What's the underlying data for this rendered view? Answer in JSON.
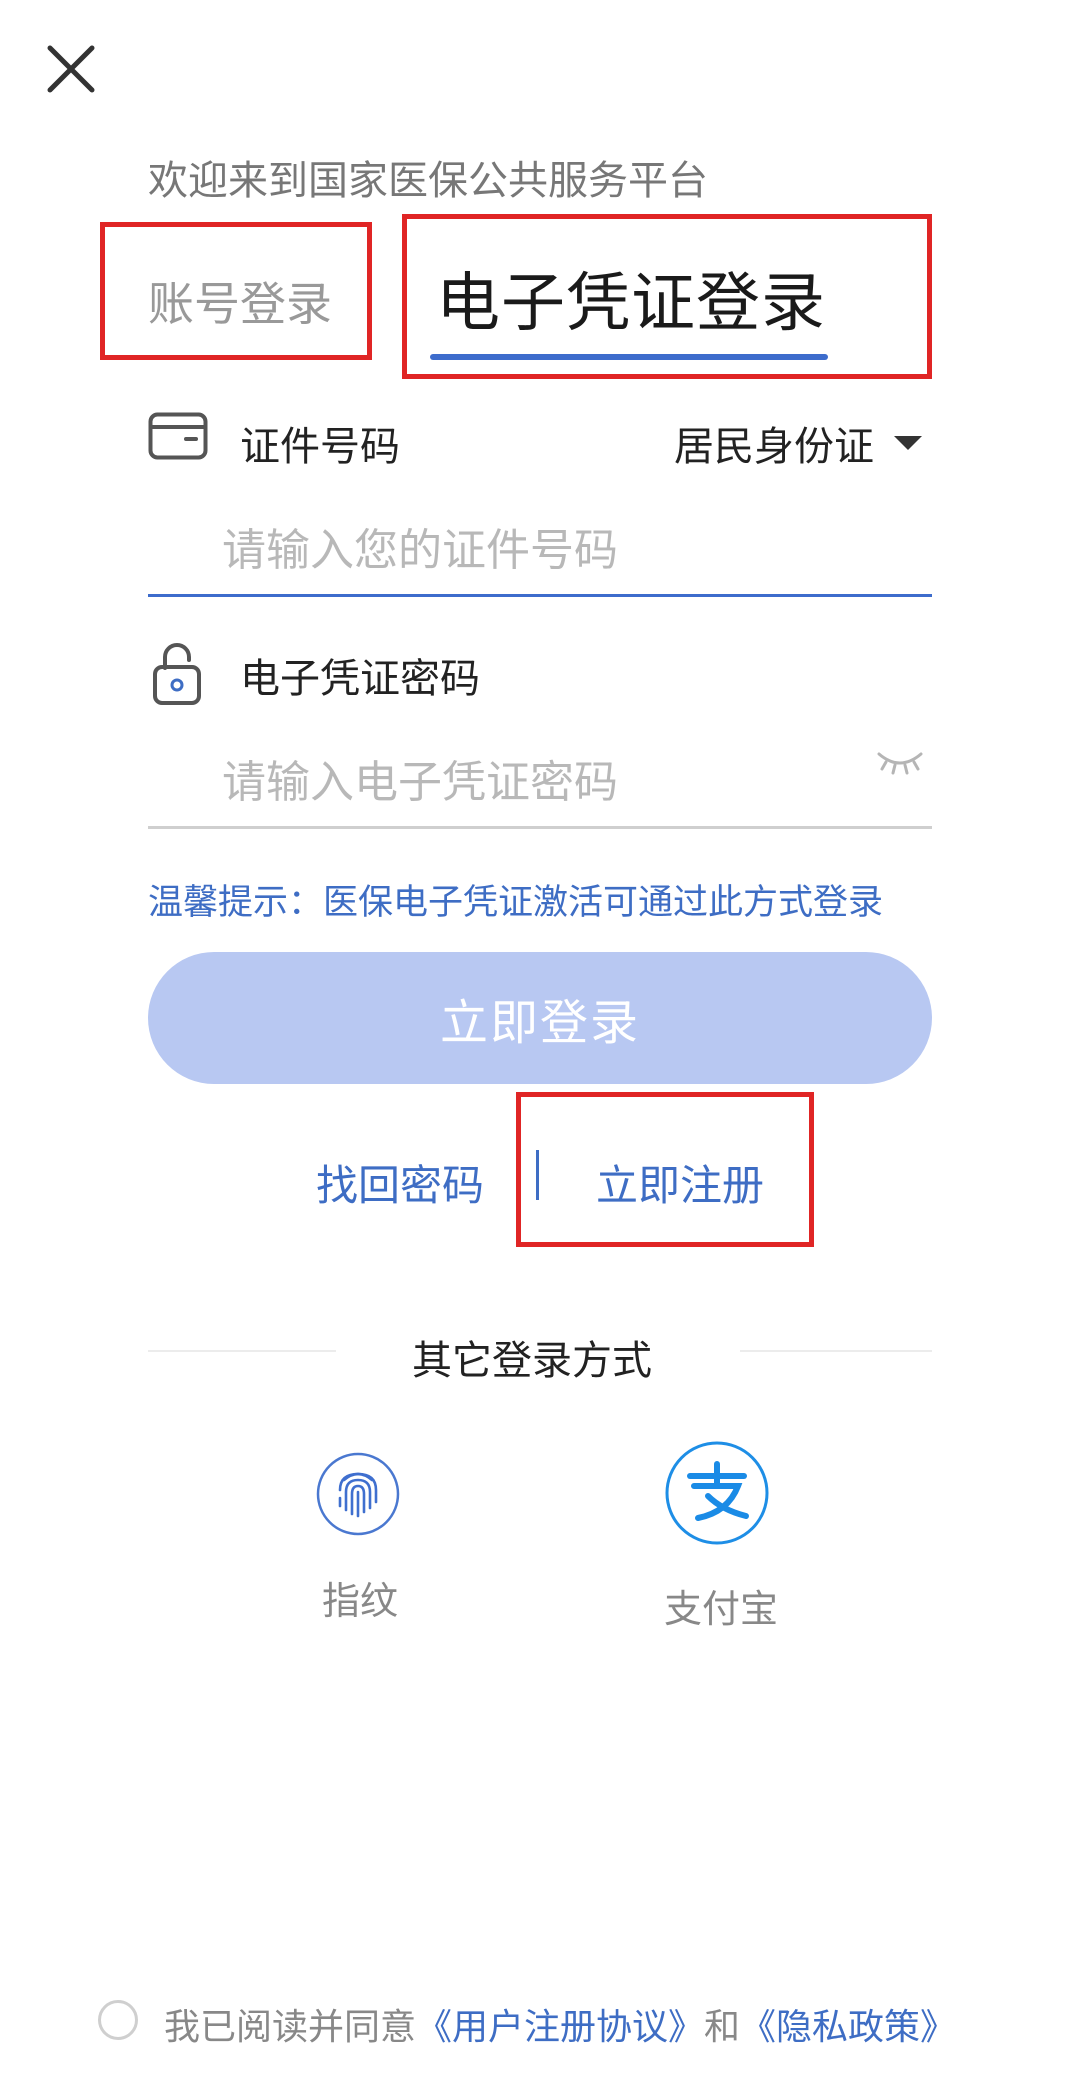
{
  "header": {
    "close_icon": "close-icon",
    "welcome": "欢迎来到国家医保公共服务平台"
  },
  "tabs": {
    "account": "账号登录",
    "ecert": "电子凭证登录",
    "active": "ecert",
    "active_color": "#3d6ccc",
    "highlight_color": "#e02525"
  },
  "id_field": {
    "icon": "id-card-icon",
    "label": "证件号码",
    "type_value": "居民身份证",
    "placeholder": "请输入您的证件号码"
  },
  "pwd_field": {
    "icon": "lock-icon",
    "label": "电子凭证密码",
    "placeholder": "请输入电子凭证密码",
    "toggle_icon": "eye-closed-icon"
  },
  "tip": "温馨提示：医保电子凭证激活可通过此方式登录",
  "login_button": "立即登录",
  "links": {
    "forgot": "找回密码",
    "register": "立即注册"
  },
  "other_login": {
    "title": "其它登录方式",
    "methods": [
      {
        "label": "指纹",
        "icon": "fingerprint-icon"
      },
      {
        "label": "支付宝",
        "icon": "alipay-icon"
      }
    ]
  },
  "agreement": {
    "prefix": "我已阅读并同意",
    "user_agreement": "《用户注册协议》",
    "and": "和",
    "privacy": "《隐私政策》"
  }
}
